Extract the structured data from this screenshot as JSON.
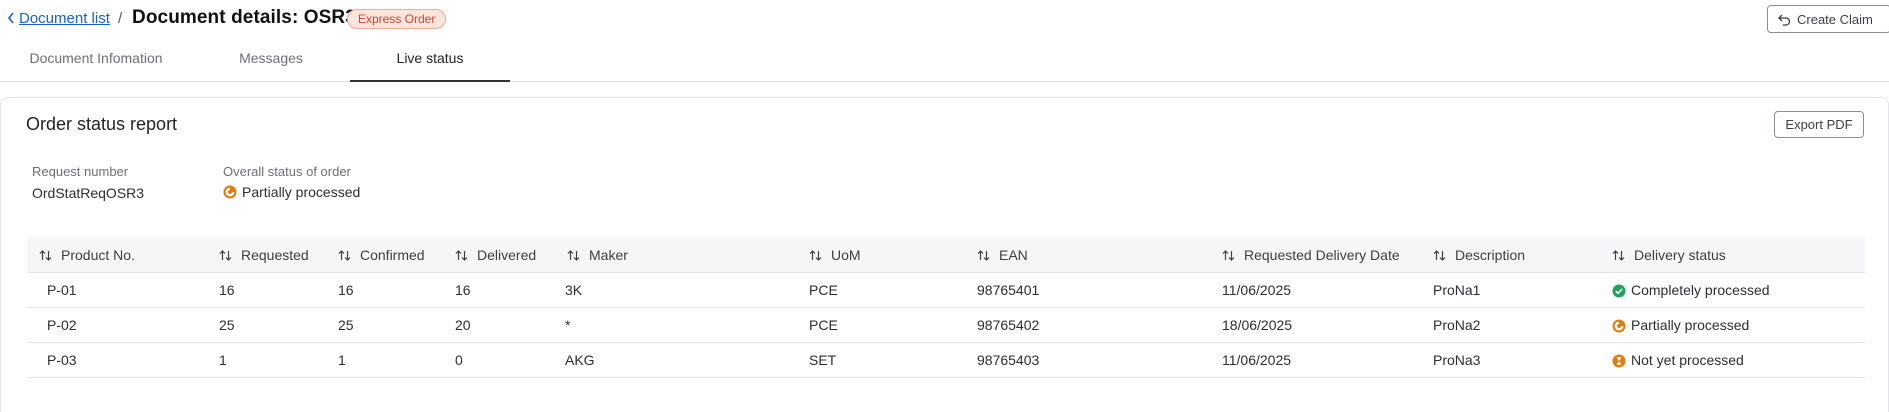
{
  "breadcrumb": {
    "link_label": "Document list",
    "separator": "/"
  },
  "page": {
    "title": "Document details: OSR3",
    "badge": "Express Order"
  },
  "actions": {
    "create_claim": "Create Claim",
    "export_pdf": "Export PDF"
  },
  "tabs": [
    {
      "label": "Document Infomation",
      "active": false
    },
    {
      "label": "Messages",
      "active": false
    },
    {
      "label": "Live status",
      "active": true
    }
  ],
  "report": {
    "title": "Order status report",
    "request_number_label": "Request number",
    "request_number": "OrdStatReqOSR3",
    "overall_status_label": "Overall status of order",
    "overall_status": "Partially processed",
    "overall_status_icon": "partial-status-icon"
  },
  "colors": {
    "completed": "#22a35a",
    "partial": "#e07d10",
    "not_yet": "#e07d10",
    "link": "#1a5fd1",
    "badge_text": "#d2432e",
    "badge_bg": "#fde4dd"
  },
  "table": {
    "columns": [
      "Product No.",
      "Requested",
      "Confirmed",
      "Delivered",
      "Maker",
      "UoM",
      "EAN",
      "Requested Delivery Date",
      "Description",
      "Delivery status"
    ],
    "rows": [
      {
        "product": "P-01",
        "requested": "16",
        "confirmed": "16",
        "delivered": "16",
        "maker": "3K",
        "uom": "PCE",
        "ean": "98765401",
        "date": "11/06/2025",
        "description": "ProNa1",
        "status": "Completely processed",
        "status_icon": "check-circle-icon"
      },
      {
        "product": "P-02",
        "requested": "25",
        "confirmed": "25",
        "delivered": "20",
        "maker": "*",
        "uom": "PCE",
        "ean": "98765402",
        "date": "18/06/2025",
        "description": "ProNa2",
        "status": "Partially processed",
        "status_icon": "partial-status-icon"
      },
      {
        "product": "P-03",
        "requested": "1",
        "confirmed": "1",
        "delivered": "0",
        "maker": "AKG",
        "uom": "SET",
        "ean": "98765403",
        "date": "11/06/2025",
        "description": "ProNa3",
        "status": "Not yet processed",
        "status_icon": "hourglass-icon"
      }
    ]
  }
}
